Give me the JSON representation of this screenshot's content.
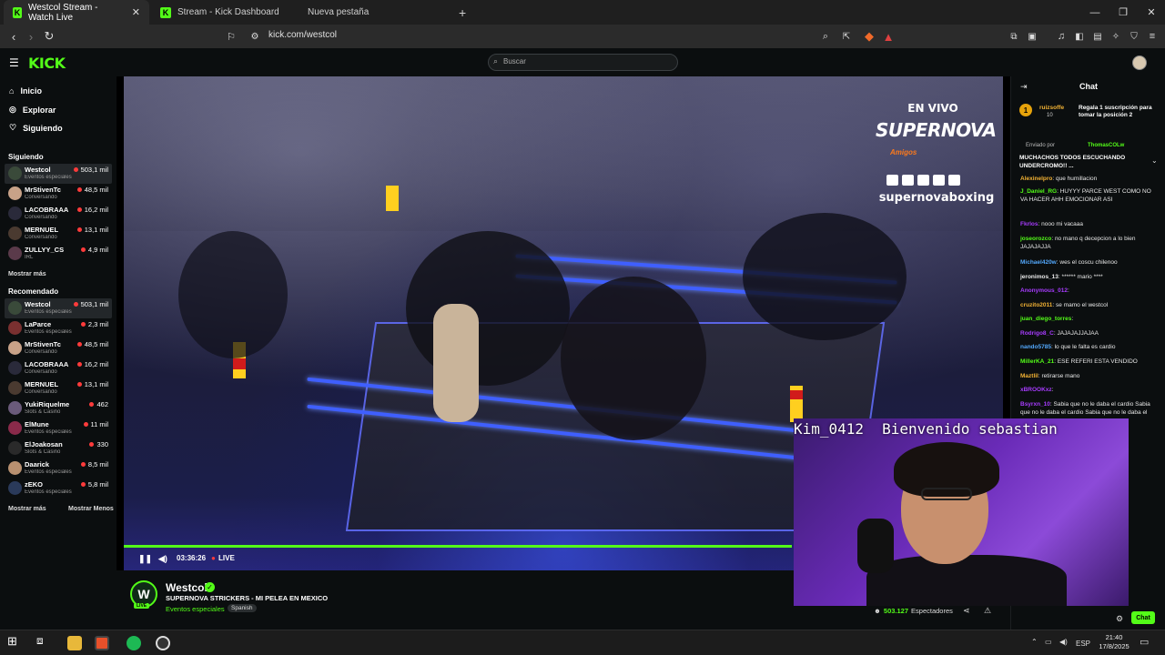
{
  "browser": {
    "tabs": [
      {
        "label": "Westcol Stream - Watch Live"
      },
      {
        "label": "Stream - Kick Dashboard"
      },
      {
        "label": "Nueva pestaña"
      }
    ],
    "url": "kick.com/westcol"
  },
  "header": {
    "logo": "KICK",
    "search_placeholder": "Buscar"
  },
  "sidebar": {
    "nav": [
      {
        "label": "Inicio",
        "icon": "home-icon"
      },
      {
        "label": "Explorar",
        "icon": "compass-icon"
      },
      {
        "label": "Siguiendo",
        "icon": "heart-icon"
      }
    ],
    "following_title": "Siguiendo",
    "following": [
      {
        "name": "Westcol",
        "category": "Eventos especiales",
        "viewers": "503,1 mil",
        "avatar": "#3a4a3a"
      },
      {
        "name": "MrStivenTc",
        "category": "Conversando",
        "viewers": "48,5 mil",
        "avatar": "#c8a288"
      },
      {
        "name": "LACOBRAAA",
        "category": "Conversando",
        "viewers": "16,2 mil",
        "avatar": "#2a2a3a"
      },
      {
        "name": "MERNUEL",
        "category": "Conversando",
        "viewers": "13,1 mil",
        "avatar": "#4a3a30"
      },
      {
        "name": "ZULLYY_CS",
        "category": "IRL",
        "viewers": "4,9 mil",
        "avatar": "#5a3a4a"
      }
    ],
    "show_more": "Mostrar más",
    "recommended_title": "Recomendado",
    "recommended": [
      {
        "name": "Westcol",
        "category": "Eventos especiales",
        "viewers": "503,1 mil",
        "avatar": "#3a4a3a"
      },
      {
        "name": "LaParce",
        "category": "Eventos especiales",
        "viewers": "2,3 mil",
        "avatar": "#7a3030"
      },
      {
        "name": "MrStivenTc",
        "category": "Conversando",
        "viewers": "48,5 mil",
        "avatar": "#c8a288"
      },
      {
        "name": "LACOBRAAA",
        "category": "Conversando",
        "viewers": "16,2 mil",
        "avatar": "#2a2a3a"
      },
      {
        "name": "MERNUEL",
        "category": "Conversando",
        "viewers": "13,1 mil",
        "avatar": "#4a3a30"
      },
      {
        "name": "YukiRiquelme",
        "category": "Slots & Casino",
        "viewers": "462",
        "avatar": "#6a5a7a"
      },
      {
        "name": "ElMune",
        "category": "Eventos especiales",
        "viewers": "11 mil",
        "avatar": "#8a2a4a"
      },
      {
        "name": "ElJoakosan",
        "category": "Slots & Casino",
        "viewers": "330",
        "avatar": "#2a2a2a"
      },
      {
        "name": "Daarick",
        "category": "Eventos especiales",
        "viewers": "8,5 mil",
        "avatar": "#b89070"
      },
      {
        "name": "zEKO",
        "category": "Eventos especiales",
        "viewers": "5,8 mil",
        "avatar": "#2a3a5a"
      }
    ],
    "show_more2": "Mostrar más",
    "show_less": "Mostrar Menos"
  },
  "video": {
    "overlay_live": "EN VIVO",
    "overlay_brand": "SUPERNOVA",
    "overlay_sub": "Amigos",
    "overlay_handle": "supernovaboxing",
    "time": "03:36:26",
    "live_label": "LIVE",
    "progress": 1.0
  },
  "cam": {
    "user": "Kim_0412",
    "text": "Bienvenido sebastian"
  },
  "streamer": {
    "name": "Westcol",
    "title": "SUPERNOVA STRICKERS - MI PELEA EN MEXICO",
    "category": "Eventos especiales",
    "language": "Spanish",
    "viewers": "503.127",
    "viewers_label": "Espectadores"
  },
  "chat": {
    "title": "Chat",
    "pinned_user": "ruizsoffe",
    "pinned_count": "10",
    "pinned_text": "Regala 1 suscripción para tomar la posición 2",
    "sent_by": "Enviado por",
    "sent_user": "ThomasCOLw",
    "highlight": "MUCHACHOS TODOS ESCUCHANDO UNDERCROMO!! ...",
    "messages": [
      {
        "user": "Alexinelpro",
        "color": "#f2b234",
        "text": "que humillacion"
      },
      {
        "user": "J_Daniel_RG",
        "color": "#53fc18",
        "text": "HUYYY PARCE WEST COMO NO VA HACER AHH EMOCIONAR ASI"
      },
      {
        "user": "Fkrlos",
        "color": "#a83cff",
        "text": "nooo mi vacaaa"
      },
      {
        "user": "joseorozco",
        "color": "#53fc18",
        "text": "no mano q decepcion a lo bien JAJAJAJJA"
      },
      {
        "user": "Michael420w",
        "color": "#53a8fc",
        "text": "wes el coscu chilenoo"
      },
      {
        "user": "jeronimos_13",
        "color": "#e8e8e8",
        "text": "****** mario ****"
      },
      {
        "user": "Anonymous_012",
        "color": "#a83cff",
        "text": ""
      },
      {
        "user": "cruzito2011",
        "color": "#f2b234",
        "text": "se mamo el westcol"
      },
      {
        "user": "juan_diego_torres",
        "color": "#53fc18",
        "text": ""
      },
      {
        "user": "Rodrigo8_C",
        "color": "#a83cff",
        "text": "JAJAJAJJAJAA"
      },
      {
        "user": "nando5785",
        "color": "#53a8fc",
        "text": "lo que le falta es cardio"
      },
      {
        "user": "MillerKA_21",
        "color": "#53fc18",
        "text": "ESE REFERI ESTA VENDIDO"
      },
      {
        "user": "Maztlil",
        "color": "#f2b234",
        "text": "retirarse mano"
      },
      {
        "user": "xBROOKxz",
        "color": "#a83cff",
        "text": ""
      },
      {
        "user": "Bsyrxn_10",
        "color": "#a83cff",
        "text": "Sabia que no le daba el cardio Sabia que no le daba el cardio Sabia que no le daba el"
      }
    ],
    "button": "Chat"
  },
  "taskbar": {
    "lang": "ESP",
    "time": "21:40",
    "date": "17/8/2025"
  }
}
